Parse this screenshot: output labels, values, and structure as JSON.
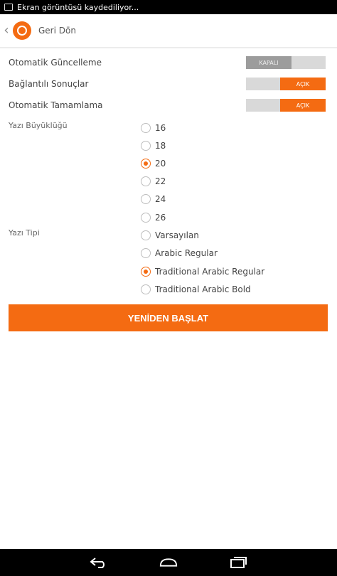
{
  "status_bar": {
    "notification_text": "Ekran görüntüsü kaydediliyor..."
  },
  "header": {
    "back_label": "Geri Dön"
  },
  "settings": [
    {
      "label": "Otomatik Güncelleme",
      "state": "off",
      "switch_text": "KAPALI"
    },
    {
      "label": "Bağlantılı Sonuçlar",
      "state": "on",
      "switch_text": "AÇIK"
    },
    {
      "label": "Otomatik Tamamlama",
      "state": "on",
      "switch_text": "AÇIK"
    }
  ],
  "font_size": {
    "label": "Yazı Büyüklüğü",
    "options": [
      "16",
      "18",
      "20",
      "22",
      "24",
      "26"
    ],
    "selected": "20"
  },
  "font_type": {
    "label": "Yazı Tipi",
    "options": [
      "Varsayılan",
      "Arabic Regular",
      "Traditional Arabic Regular",
      "Traditional Arabic Bold"
    ],
    "selected": "Traditional Arabic Regular"
  },
  "restart_button": {
    "label": "YENİDEN BAŞLAT"
  },
  "colors": {
    "accent": "#f46b12",
    "switch_off": "#9c9c9c",
    "switch_track": "#d9d9d9"
  },
  "nav_icons": [
    "back-icon",
    "home-icon",
    "recent-apps-icon"
  ]
}
